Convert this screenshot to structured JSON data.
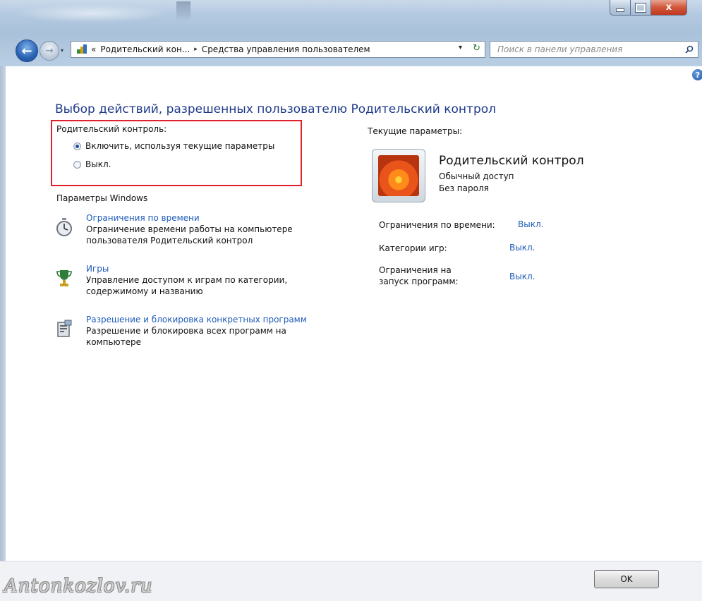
{
  "window": {
    "minimize_glyph": "–",
    "close_glyph": "x"
  },
  "nav": {
    "back_glyph": "←",
    "forward_glyph": "→",
    "history_glyph": "▾",
    "breadcrumb_prefix": "«",
    "crumbs": [
      "Родительский кон...",
      "Средства управления пользователем"
    ],
    "crumb_separator": "▸",
    "address_dropdown_glyph": "▾",
    "refresh_glyph": "↻",
    "search_placeholder": "Поиск в панели управления"
  },
  "help_glyph": "?",
  "page_title": "Выбор действий, разрешенных пользователю Родительский контрол",
  "parental_control": {
    "label": "Родительский контроль:",
    "options": [
      {
        "label": "Включить, используя текущие параметры",
        "checked": true
      },
      {
        "label": "Выкл.",
        "checked": false
      }
    ]
  },
  "windows_settings": {
    "heading": "Параметры Windows",
    "items": [
      {
        "icon": "stopwatch-icon",
        "link": "Ограничения по времени",
        "desc_line1": "Ограничение времени работы на компьютере",
        "desc_line2": "пользователя Родительский контрол"
      },
      {
        "icon": "trophy-icon",
        "link": "Игры",
        "desc_line1": "Управление доступом к играм по категории,",
        "desc_line2": "содержимому и названию"
      },
      {
        "icon": "program-block-icon",
        "link": "Разрешение и блокировка конкретных программ",
        "desc_line1": "Разрешение и блокировка всех программ на",
        "desc_line2": "компьютере"
      }
    ]
  },
  "current": {
    "heading": "Текущие параметры:",
    "user_name": "Родительский контрол",
    "account_type": "Обычный доступ",
    "password_status": "Без пароля",
    "rows": [
      {
        "label_line1": "Ограничения по времени:",
        "label_line2": "",
        "value": "Выкл."
      },
      {
        "label_line1": "Категории игр:",
        "label_line2": "",
        "value": "Выкл."
      },
      {
        "label_line1": "Ограничения на",
        "label_line2": "запуск программ:",
        "value": "Выкл."
      }
    ]
  },
  "ok_label": "OK",
  "watermark": "Antonkozlov.ru",
  "colors": {
    "link": "#1e5bb8",
    "title": "#1e3a8a",
    "highlight_box": "#e0202a"
  }
}
